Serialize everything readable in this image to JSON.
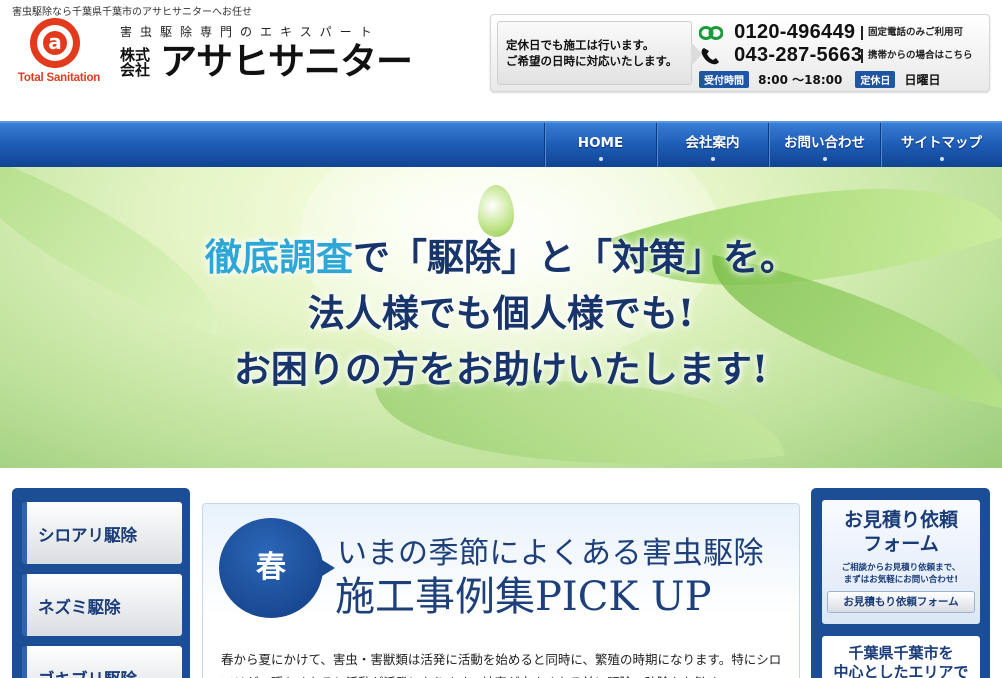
{
  "header": {
    "tagline": "害虫駆除なら千葉県千葉市のアサヒサニターへお任せ",
    "logo_text": "Total Sanitation",
    "company_subtitle": "害虫駆除専門のエキスパート",
    "company_type": "株式会社",
    "company_name": "アサヒサニター",
    "contact": {
      "note_line1": "定休日でも施工は行います。",
      "note_line2": "ご希望の日時に対応いたします。",
      "freedial_number": "0120-496449",
      "freedial_note": "固定電話のみご利用可",
      "phone_number": "043-287-5663",
      "phone_note": "携帯からの場合はこちら",
      "hours_label": "受付時間",
      "hours_value": "8:00 〜18:00",
      "holiday_label": "定休日",
      "holiday_value": "日曜日"
    }
  },
  "nav": {
    "items": [
      {
        "label": "HOME"
      },
      {
        "label": "会社案内"
      },
      {
        "label": "お問い合わせ"
      },
      {
        "label": "サイトマップ"
      }
    ]
  },
  "hero": {
    "line1_accent": "徹底調査",
    "line1_rest": "で「駆除」と「対策」を。",
    "line2": "法人様でも個人様でも!",
    "line3": "お困りの方をお助けいたします!"
  },
  "sidebar_left": {
    "items": [
      {
        "label": "シロアリ駆除"
      },
      {
        "label": "ネズミ駆除"
      },
      {
        "label": "ゴキブリ駆除"
      }
    ]
  },
  "main": {
    "season": "春",
    "title_line1": "いまの季節によくある害虫駆除",
    "title_line2": "施工事例集PICK UP",
    "body": "春から夏にかけて、害虫・害獣類は活発に活動を始めると同時に、繁殖の時期になります。特にシロアリが、暖かくなると活動が活発になります。被害が大きくなる前に駆除・防除をお勧め"
  },
  "sidebar_right": {
    "estimate_title_line1": "お見積り依頼",
    "estimate_title_line2": "フォーム",
    "estimate_note_line1": "ご相談からお見積り依頼まで、",
    "estimate_note_line2": "まずはお気軽にお問い合わせ!",
    "estimate_button": "お見積もり依頼フォーム",
    "area_line1": "千葉県千葉市を",
    "area_line2": "中心としたエリアで"
  },
  "colors": {
    "brand_red": "#e23a1c",
    "nav_blue": "#1f5fb8",
    "dark_navy": "#1b4e95",
    "accent_cyan": "#2ea7d6"
  }
}
